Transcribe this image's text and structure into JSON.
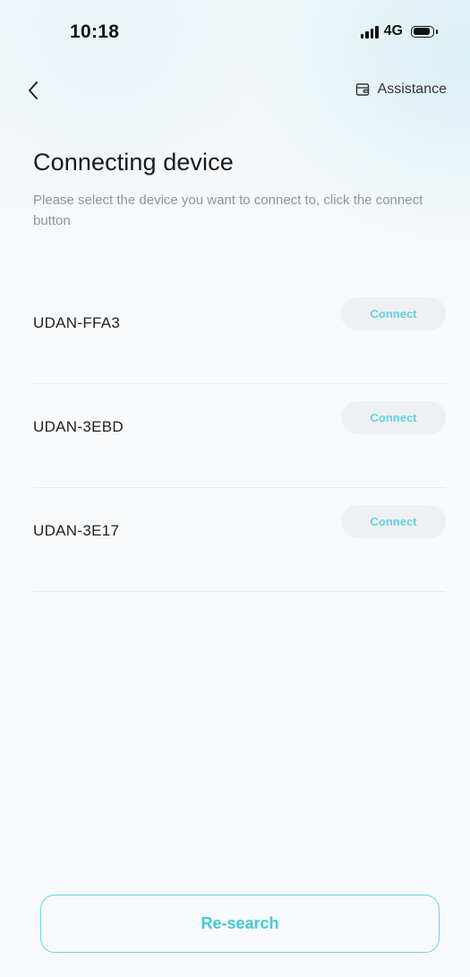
{
  "status_bar": {
    "time": "10:18",
    "network": "4G",
    "icons": [
      "signal-icon",
      "battery-icon"
    ]
  },
  "nav": {
    "back_icon": "chevron-left-icon",
    "assistance_icon": "wallet-icon",
    "assistance_label": "Assistance"
  },
  "header": {
    "title": "Connecting device",
    "subtitle": "Please select the device you want to connect to, click the connect button"
  },
  "devices": [
    {
      "name": "UDAN-FFA3",
      "action_label": "Connect"
    },
    {
      "name": "UDAN-3EBD",
      "action_label": "Connect"
    },
    {
      "name": "UDAN-3E17",
      "action_label": "Connect"
    }
  ],
  "footer": {
    "research_label": "Re-search"
  },
  "colors": {
    "accent": "#45c9d6",
    "connect_text": "#5fd3de",
    "connect_bg": "#eef0f2",
    "subtitle": "#8e9499",
    "title": "#1a1a1a"
  }
}
